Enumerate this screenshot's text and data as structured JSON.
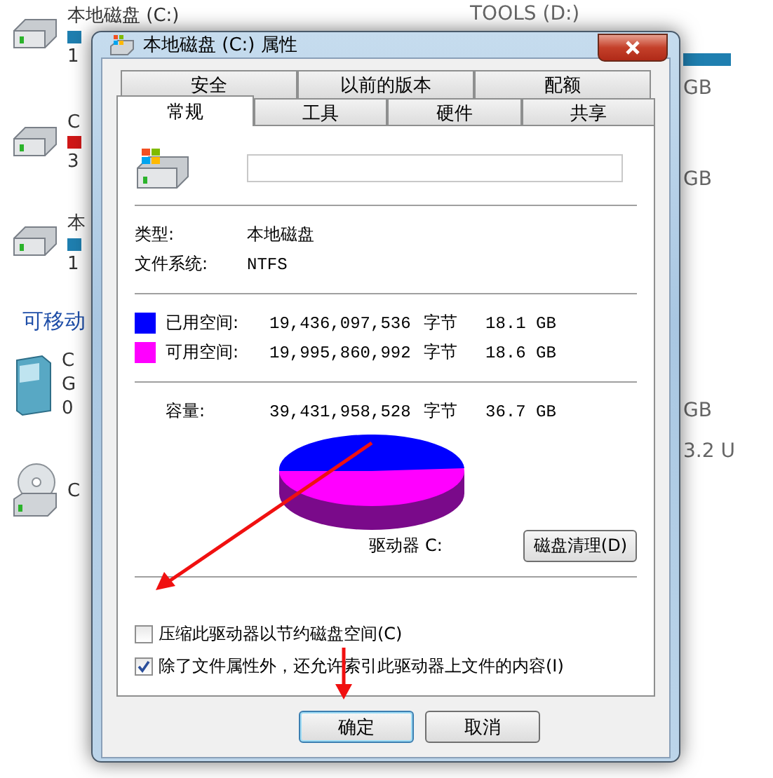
{
  "background": {
    "left_items": [
      {
        "text": "本地磁盘 (C:)",
        "kind": "drive",
        "color": "#1f7fb0",
        "detail": "1"
      },
      {
        "text": "C",
        "kind": "drive",
        "color": "#d01818",
        "detail": "3"
      },
      {
        "text": "本",
        "kind": "drive",
        "color": "#1f7fb0",
        "detail": "1"
      },
      {
        "text": "C",
        "kind": "removable",
        "line2": "G",
        "detail": "0",
        "heading": "可移动"
      },
      {
        "text": "C",
        "kind": "cd"
      }
    ],
    "right_items": [
      {
        "text": "TOOLS (D:)",
        "kind": "bar-label"
      },
      {
        "text": "GB",
        "kind": "size"
      },
      {
        "text": "GB",
        "kind": "size"
      },
      {
        "text": "GB",
        "kind": "size"
      },
      {
        "text": "3.2 U",
        "kind": "size"
      }
    ]
  },
  "window": {
    "title": "本地磁盘 (C:) 属性"
  },
  "tab_rows": [
    [
      {
        "label": "安全",
        "selected": false
      },
      {
        "label": "以前的版本",
        "selected": false
      },
      {
        "label": "配额",
        "selected": false
      }
    ],
    [
      {
        "label": "常规",
        "selected": true
      },
      {
        "label": "工具",
        "selected": false
      },
      {
        "label": "硬件",
        "selected": false
      },
      {
        "label": "共享",
        "selected": false
      }
    ]
  ],
  "general": {
    "type_label": "类型:",
    "type_value": "本地磁盘",
    "fs_label": "文件系统:",
    "fs_value": "NTFS",
    "space": [
      {
        "label": "已用空间:",
        "bytes": "19,436,097,536",
        "unit": "字节",
        "size": "18.1 GB",
        "color": "#0000ff"
      },
      {
        "label": "可用空间:",
        "bytes": "19,995,860,992",
        "unit": "字节",
        "size": "18.6 GB",
        "color": "#ff00ff"
      }
    ],
    "capacity": {
      "label": "容量:",
      "bytes": "39,431,958,528",
      "unit": "字节",
      "size": "36.7 GB"
    },
    "drive_label": "驱动器 C:",
    "cleanup_button": "磁盘清理(D)",
    "options": [
      {
        "label": "压缩此驱动器以节约磁盘空间(C)",
        "checked": false
      },
      {
        "label": "除了文件属性外，还允许索引此驱动器上文件的内容(I)",
        "checked": true
      }
    ]
  },
  "buttons": [
    {
      "label": "确定",
      "kind": "default"
    },
    {
      "label": "取消",
      "kind": "normal"
    }
  ]
}
